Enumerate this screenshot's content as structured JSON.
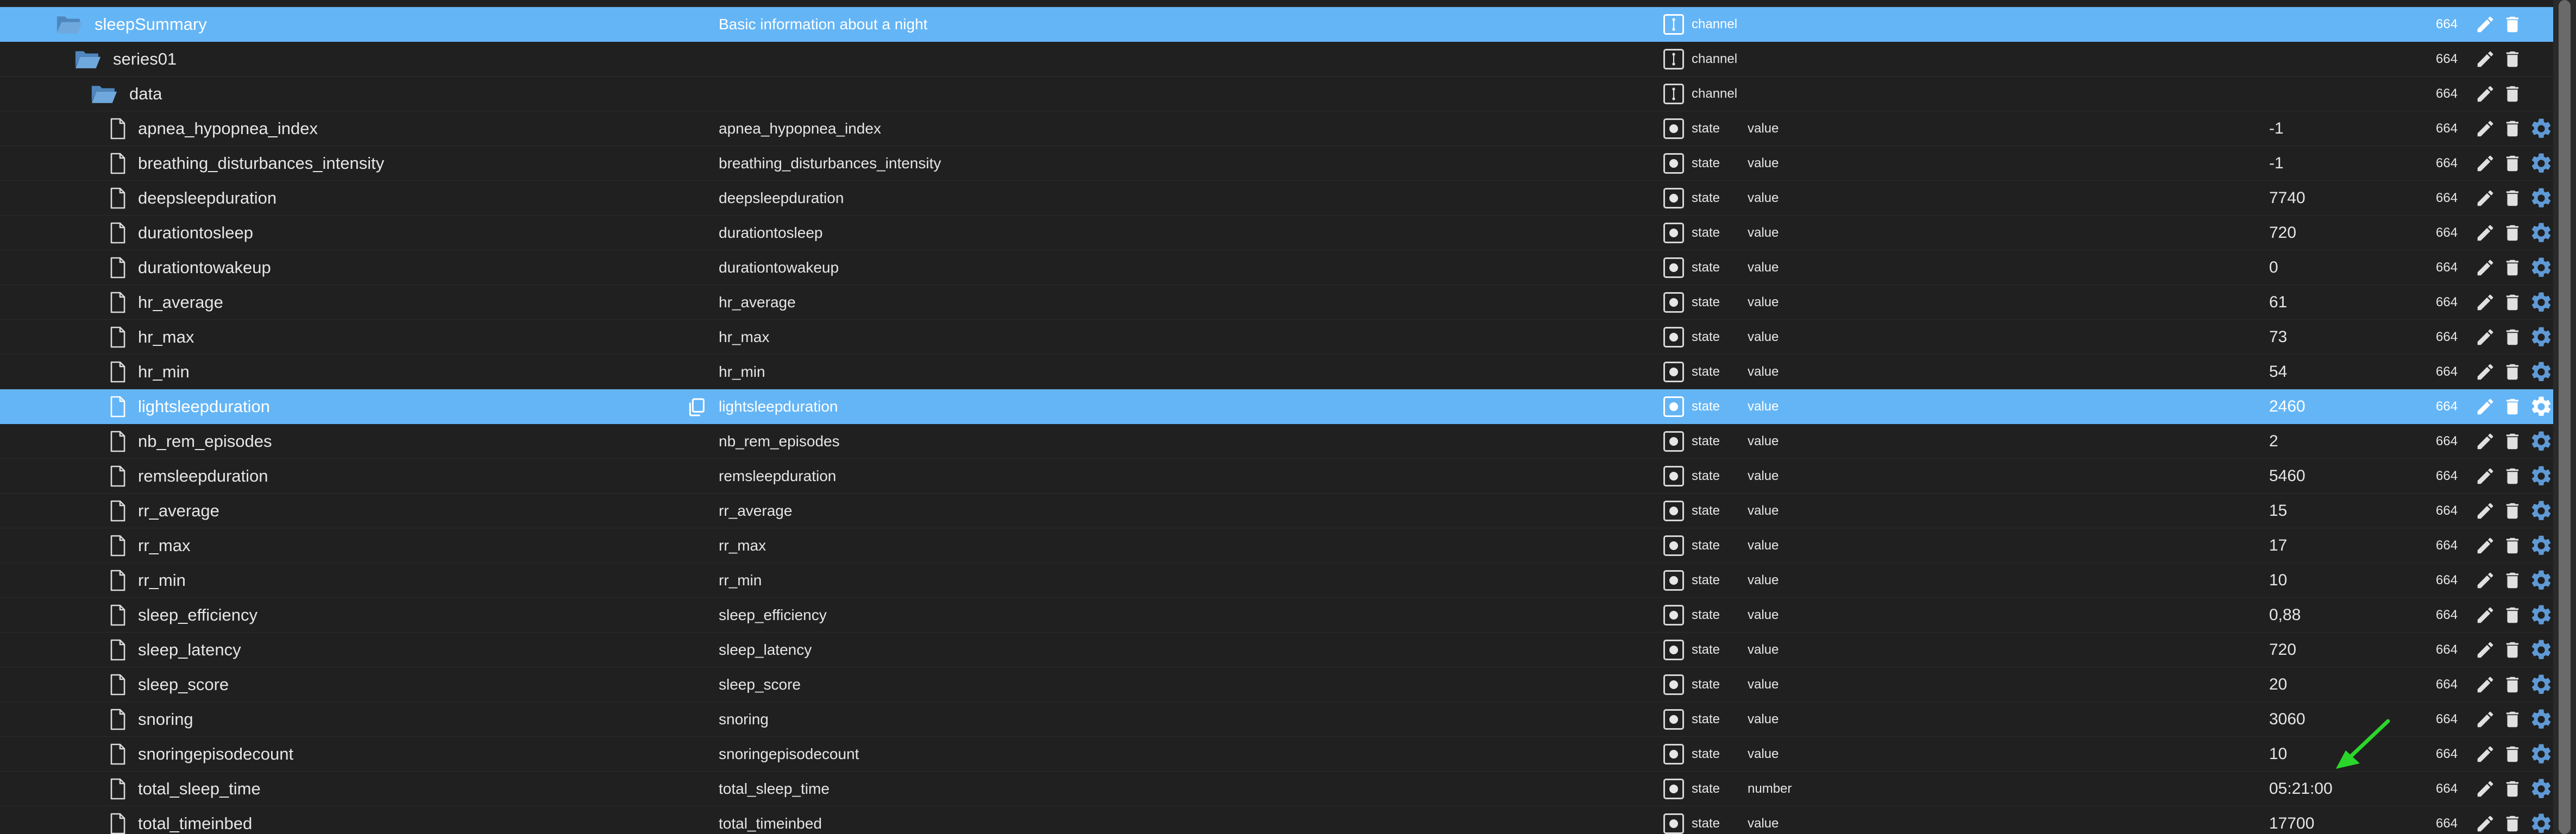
{
  "colors": {
    "background": "#202020",
    "selected_row": "#64b5f6",
    "folder_icon": "#6fa8dc",
    "gear_icon": "#5f9ad6",
    "arrow": "#2bd62b"
  },
  "rows": [
    {
      "kind": "partial"
    },
    {
      "kind": "channel",
      "indent": 1,
      "icon": "folder-open-icon",
      "name": "sleepSummary",
      "desc": "Basic information about a night",
      "type": "channel",
      "role": "",
      "value": "",
      "acl": "664",
      "selected": true,
      "gear": false
    },
    {
      "kind": "channel",
      "indent": 2,
      "icon": "folder-open-icon",
      "name": "series01",
      "desc": "",
      "type": "channel",
      "role": "",
      "value": "",
      "acl": "664",
      "selected": false,
      "gear": false
    },
    {
      "kind": "channel",
      "indent": 3,
      "icon": "folder-open-icon",
      "name": "data",
      "desc": "",
      "type": "channel",
      "role": "",
      "value": "",
      "acl": "664",
      "selected": false,
      "gear": false
    },
    {
      "kind": "state",
      "indent": 4,
      "icon": "file-icon",
      "name": "apnea_hypopnea_index",
      "desc": "apnea_hypopnea_index",
      "type": "state",
      "role": "value",
      "value": "-1",
      "acl": "664",
      "selected": false,
      "gear": true
    },
    {
      "kind": "state",
      "indent": 4,
      "icon": "file-icon",
      "name": "breathing_disturbances_intensity",
      "desc": "breathing_disturbances_intensity",
      "type": "state",
      "role": "value",
      "value": "-1",
      "acl": "664",
      "selected": false,
      "gear": true
    },
    {
      "kind": "state",
      "indent": 4,
      "icon": "file-icon",
      "name": "deepsleepduration",
      "desc": "deepsleepduration",
      "type": "state",
      "role": "value",
      "value": "7740",
      "acl": "664",
      "selected": false,
      "gear": true
    },
    {
      "kind": "state",
      "indent": 4,
      "icon": "file-icon",
      "name": "durationtosleep",
      "desc": "durationtosleep",
      "type": "state",
      "role": "value",
      "value": "720",
      "acl": "664",
      "selected": false,
      "gear": true
    },
    {
      "kind": "state",
      "indent": 4,
      "icon": "file-icon",
      "name": "durationtowakeup",
      "desc": "durationtowakeup",
      "type": "state",
      "role": "value",
      "value": "0",
      "acl": "664",
      "selected": false,
      "gear": true
    },
    {
      "kind": "state",
      "indent": 4,
      "icon": "file-icon",
      "name": "hr_average",
      "desc": "hr_average",
      "type": "state",
      "role": "value",
      "value": "61",
      "acl": "664",
      "selected": false,
      "gear": true
    },
    {
      "kind": "state",
      "indent": 4,
      "icon": "file-icon",
      "name": "hr_max",
      "desc": "hr_max",
      "type": "state",
      "role": "value",
      "value": "73",
      "acl": "664",
      "selected": false,
      "gear": true
    },
    {
      "kind": "state",
      "indent": 4,
      "icon": "file-icon",
      "name": "hr_min",
      "desc": "hr_min",
      "type": "state",
      "role": "value",
      "value": "54",
      "acl": "664",
      "selected": false,
      "gear": true
    },
    {
      "kind": "state",
      "indent": 4,
      "icon": "file-icon",
      "name": "lightsleepduration",
      "desc": "lightsleepduration",
      "type": "state",
      "role": "value",
      "value": "2460",
      "acl": "664",
      "selected": true,
      "gear": true,
      "copy": true
    },
    {
      "kind": "state",
      "indent": 4,
      "icon": "file-icon",
      "name": "nb_rem_episodes",
      "desc": "nb_rem_episodes",
      "type": "state",
      "role": "value",
      "value": "2",
      "acl": "664",
      "selected": false,
      "gear": true
    },
    {
      "kind": "state",
      "indent": 4,
      "icon": "file-icon",
      "name": "remsleepduration",
      "desc": "remsleepduration",
      "type": "state",
      "role": "value",
      "value": "5460",
      "acl": "664",
      "selected": false,
      "gear": true
    },
    {
      "kind": "state",
      "indent": 4,
      "icon": "file-icon",
      "name": "rr_average",
      "desc": "rr_average",
      "type": "state",
      "role": "value",
      "value": "15",
      "acl": "664",
      "selected": false,
      "gear": true
    },
    {
      "kind": "state",
      "indent": 4,
      "icon": "file-icon",
      "name": "rr_max",
      "desc": "rr_max",
      "type": "state",
      "role": "value",
      "value": "17",
      "acl": "664",
      "selected": false,
      "gear": true
    },
    {
      "kind": "state",
      "indent": 4,
      "icon": "file-icon",
      "name": "rr_min",
      "desc": "rr_min",
      "type": "state",
      "role": "value",
      "value": "10",
      "acl": "664",
      "selected": false,
      "gear": true
    },
    {
      "kind": "state",
      "indent": 4,
      "icon": "file-icon",
      "name": "sleep_efficiency",
      "desc": "sleep_efficiency",
      "type": "state",
      "role": "value",
      "value": "0,88",
      "acl": "664",
      "selected": false,
      "gear": true
    },
    {
      "kind": "state",
      "indent": 4,
      "icon": "file-icon",
      "name": "sleep_latency",
      "desc": "sleep_latency",
      "type": "state",
      "role": "value",
      "value": "720",
      "acl": "664",
      "selected": false,
      "gear": true
    },
    {
      "kind": "state",
      "indent": 4,
      "icon": "file-icon",
      "name": "sleep_score",
      "desc": "sleep_score",
      "type": "state",
      "role": "value",
      "value": "20",
      "acl": "664",
      "selected": false,
      "gear": true
    },
    {
      "kind": "state",
      "indent": 4,
      "icon": "file-icon",
      "name": "snoring",
      "desc": "snoring",
      "type": "state",
      "role": "value",
      "value": "3060",
      "acl": "664",
      "selected": false,
      "gear": true
    },
    {
      "kind": "state",
      "indent": 4,
      "icon": "file-icon",
      "name": "snoringepisodecount",
      "desc": "snoringepisodecount",
      "type": "state",
      "role": "value",
      "value": "10",
      "acl": "664",
      "selected": false,
      "gear": true
    },
    {
      "kind": "state",
      "indent": 4,
      "icon": "file-icon",
      "name": "total_sleep_time",
      "desc": "total_sleep_time",
      "type": "state",
      "role": "number",
      "value": "05:21:00",
      "acl": "664",
      "selected": false,
      "gear": true
    },
    {
      "kind": "state",
      "indent": 4,
      "icon": "file-icon",
      "name": "total_timeinbed",
      "desc": "total_timeinbed",
      "type": "state",
      "role": "value",
      "value": "17700",
      "acl": "664",
      "selected": false,
      "gear": true
    }
  ],
  "annotation": {
    "icon": "arrow-icon",
    "target": "total_sleep_time"
  }
}
